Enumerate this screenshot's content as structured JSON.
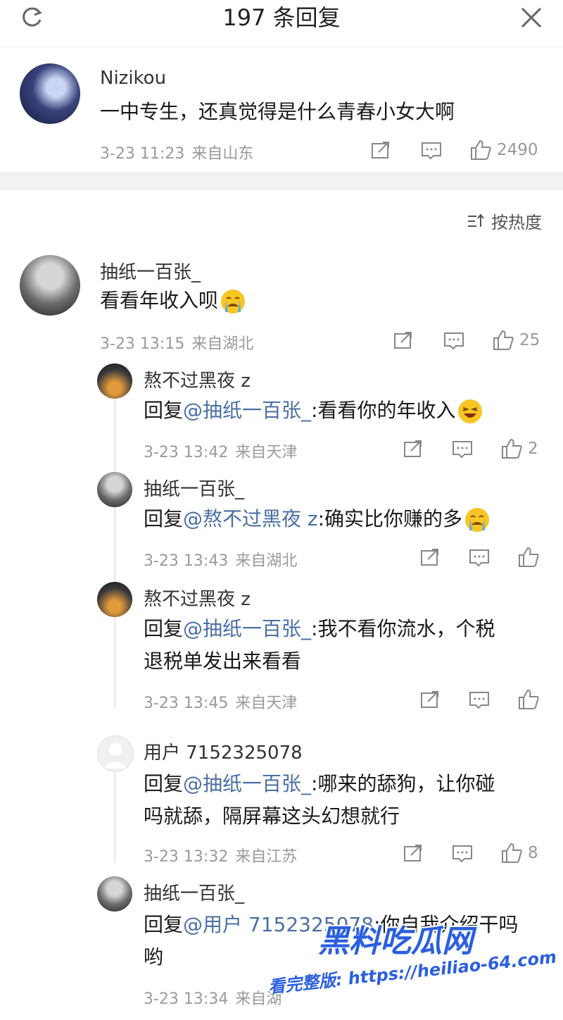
{
  "header": {
    "title": "197 条回复"
  },
  "root": {
    "name": "Nizikou",
    "text": "一中专生，还真觉得是什么青春小女大啊",
    "time": "3-23 11:23",
    "loc": "来自山东",
    "likes": "2490"
  },
  "sort_label": "按热度",
  "comment": {
    "name": "抽纸一百张_",
    "text": "看看年收入呗",
    "time": "3-23 13:15",
    "loc": "来自湖北",
    "likes": "25"
  },
  "replies": [
    {
      "name": "熬不过黑夜 z",
      "prefix": "回复",
      "mention": "@抽纸一百张_",
      "body": ":看看你的年收入",
      "time": "3-23 13:42",
      "loc": "来自天津",
      "likes": "2"
    },
    {
      "name": "抽纸一百张_",
      "prefix": "回复",
      "mention": "@熬不过黑夜 z",
      "body": ":确实比你赚的多",
      "time": "3-23 13:43",
      "loc": "来自湖北",
      "likes": ""
    },
    {
      "name": "熬不过黑夜 z",
      "prefix": "回复",
      "mention": "@抽纸一百张_",
      "body": ":我不看你流水，个税",
      "body2": "退税单发出来看看",
      "time": "3-23 13:45",
      "loc": "来自天津",
      "likes": ""
    },
    {
      "name": "用户 7152325078",
      "prefix": "回复",
      "mention": "@抽纸一百张_",
      "body": ":哪来的舔狗，让你碰",
      "body2": "吗就舔，隔屏幕这头幻想就行",
      "time": "3-23 13:32",
      "loc": "来自江苏",
      "likes": "8"
    },
    {
      "name": "抽纸一百张_",
      "prefix": "回复",
      "mention": "@用户 7152325078",
      "body": ":你自我介绍干吗",
      "body2": "哟",
      "time": "3-23 13:34",
      "loc": "来自湖",
      "likes": ""
    }
  ],
  "watermark": {
    "brand": "黑料吃瓜网",
    "line": "看完整版: https://heiliao-64.com"
  },
  "colors": {
    "mention": "#4a6fa5",
    "meta": "#9a9a9a",
    "divider": "#f2f2f2"
  }
}
